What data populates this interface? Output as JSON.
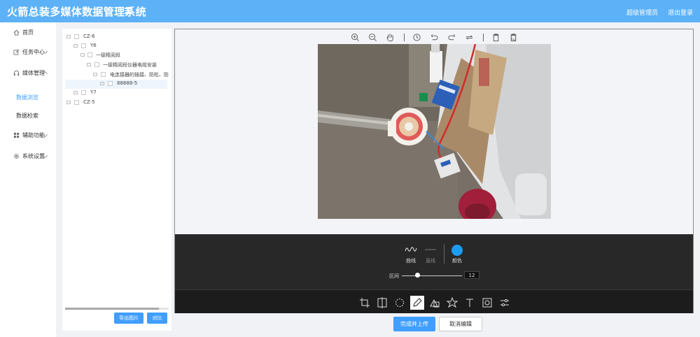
{
  "header": {
    "title": "火箭总装多媒体数据管理系统",
    "user": "超级管理员",
    "logout": "退出登录"
  },
  "sidebar": {
    "items": [
      {
        "label": "首页",
        "icon": "home-icon"
      },
      {
        "label": "任务中心",
        "icon": "edit-icon"
      },
      {
        "label": "媒体管理",
        "icon": "headset-icon"
      },
      {
        "label": "辅助功能",
        "icon": "grid-icon"
      },
      {
        "label": "系统设置",
        "icon": "gear-icon"
      }
    ],
    "sub_items": [
      {
        "label": "数据浏览",
        "active": true
      },
      {
        "label": "数据检索",
        "active": false
      }
    ]
  },
  "tree": {
    "nodes": [
      {
        "label": "CZ-6"
      },
      {
        "label": "Y6"
      },
      {
        "label": "一级精阅段"
      },
      {
        "label": "一级精阅段仪器电缆安装"
      },
      {
        "label": "电连接器的插接、防松、防热..."
      },
      {
        "label": "88888-5"
      },
      {
        "label": "Y7"
      },
      {
        "label": "CZ-5"
      }
    ],
    "export_button": "导出图片",
    "compare_button": "对比"
  },
  "editor": {
    "top_toolbar": [
      "zoom-in-icon",
      "zoom-out-icon",
      "hand-icon",
      "history-icon",
      "undo-icon",
      "redo-icon",
      "reset-icon",
      "delete-icon",
      "delete-all-icon"
    ],
    "delete_all_label": "ALL",
    "draw_options": {
      "free_line": "曲线",
      "straight_line": "直线",
      "color": "颜色",
      "color_value": "#1e9cf0",
      "range_label": "区间",
      "range_value": "12",
      "range_fraction": 0.26
    },
    "bottom_tools": [
      "crop-icon",
      "flip-icon",
      "rotate-icon",
      "draw-icon",
      "shape-icon",
      "icon-icon",
      "text-icon",
      "mask-icon",
      "filter-icon"
    ],
    "active_tool": "draw-icon"
  },
  "actions": {
    "upload": "完成并上传",
    "cancel": "取消编辑"
  },
  "colors": {
    "header": "#5cb1f7",
    "primary": "#409eff",
    "dark_panel": "#282828"
  }
}
